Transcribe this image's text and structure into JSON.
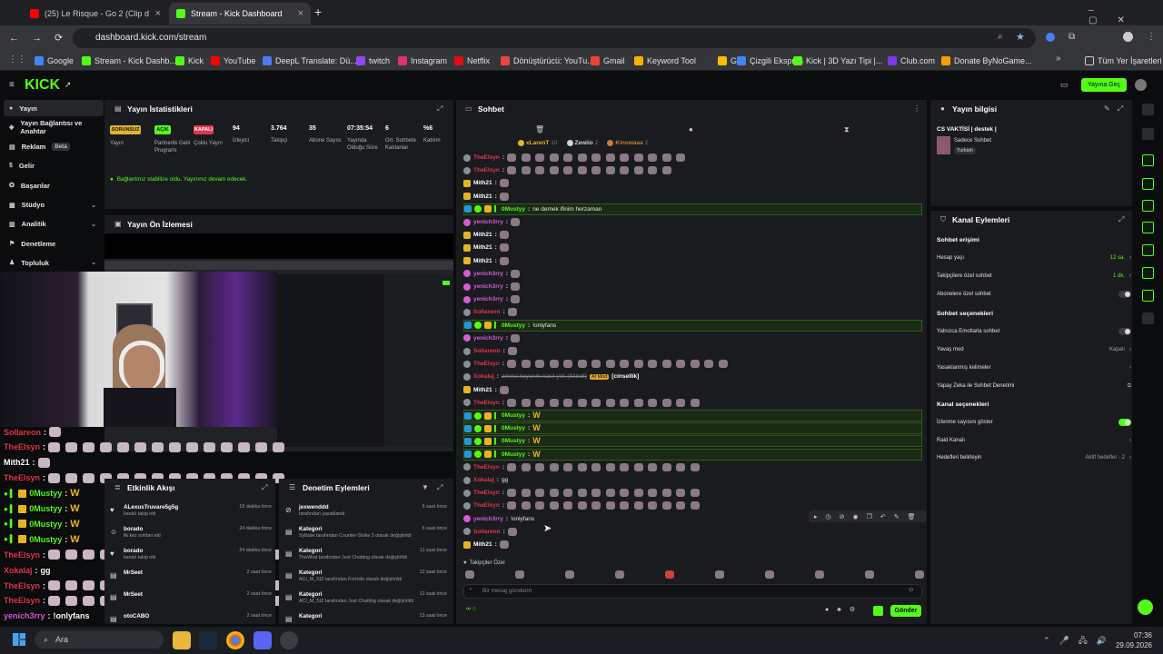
{
  "browser": {
    "tabs": [
      {
        "title": "(25) Le Risque - Go 2 (Clip d"
      },
      {
        "title": "Stream - Kick Dashboard"
      }
    ],
    "url": "dashboard.kick.com/stream",
    "bookmarks": [
      "Google",
      "Stream - Kick Dashb...",
      "Kick",
      "YouTube",
      "DeepL Translate: Dü...",
      "twitch",
      "Instagram",
      "Netflix",
      "Dönüştürücü: YouTu...",
      "Gmail",
      "Keyword Tool",
      "G...",
      "Çizgili Ekspres",
      "Kick | 3D Yazı Tipi |...",
      "Club.com",
      "Donate ByNoGame..."
    ],
    "all_bookmarks": "Tüm Yer İşaretleri"
  },
  "kick": {
    "logo": "KICK",
    "go_live": "Yayına Geç"
  },
  "sidebar": {
    "items": [
      {
        "label": "Yayın"
      },
      {
        "label": "Yayın Bağlantısı ve Anahtar"
      },
      {
        "label": "Reklam",
        "badge": "Beta"
      },
      {
        "label": "Gelir"
      },
      {
        "label": "Başarılar"
      },
      {
        "label": "Stüdyo"
      },
      {
        "label": "Analitik"
      },
      {
        "label": "Denetleme"
      },
      {
        "label": "Topluluk"
      }
    ]
  },
  "stats": {
    "title": "Yayın İstatistikleri",
    "items": [
      {
        "pill": "SORUNSUZ",
        "label": "Yayın"
      },
      {
        "pill": "AÇIK",
        "label": "Partnerlik Gelir Programı"
      },
      {
        "pill": "KAPALI",
        "label": "Çoklu Yayın"
      },
      {
        "value": "94",
        "label": "İzleyici"
      },
      {
        "value": "3.764",
        "label": "Takipçi"
      },
      {
        "value": "35",
        "label": "Abone Sayısı"
      },
      {
        "value": "07:35:54",
        "label": "Yayında Olduğu Süre"
      },
      {
        "value": "6",
        "label": "Ort. Sohbete Katılanlar"
      },
      {
        "value": "%6",
        "label": "Katılım"
      }
    ],
    "notice": "Bağlantınız stabilize oldu. Yayınınız devam edecek."
  },
  "preview": {
    "title": "Yayın Ön İzlemesi"
  },
  "overlay_chat": [
    {
      "name": "Sollareon",
      "color": "red",
      "emotes": 1
    },
    {
      "name": "TheElsyn",
      "color": "red",
      "emotes": 14
    },
    {
      "name": "Mith21",
      "color": "white",
      "emotes": 1
    },
    {
      "name": "TheElsyn",
      "color": "red",
      "emotes": 14
    },
    {
      "name": "0Mustyy",
      "color": "green",
      "emotes": 1,
      "badges": true
    },
    {
      "name": "0Mustyy",
      "color": "green",
      "emotes": 1,
      "badges": true
    },
    {
      "name": "0Mustyy",
      "color": "green",
      "emotes": 1,
      "badges": true
    },
    {
      "name": "0Mustyy",
      "color": "green",
      "emotes": 1,
      "badges": true
    },
    {
      "name": "TheElsyn",
      "color": "red",
      "emotes": 14
    },
    {
      "name": "Xokalaj",
      "color": "red",
      "text": "gg"
    },
    {
      "name": "TheElsyn",
      "color": "red",
      "emotes": 14
    },
    {
      "name": "TheElsyn",
      "color": "red",
      "emotes": 14
    },
    {
      "name": "yenich3rry",
      "color": "pink",
      "text": "!onlyfans"
    },
    {
      "name": "Sollareon",
      "color": "red",
      "emotes": 0
    },
    {
      "name": "Mith21",
      "color": "white",
      "emotes": 0
    }
  ],
  "activity": {
    "title": "Etkinlik Akışı",
    "items": [
      {
        "title": "ALexusTruvare5g5g",
        "desc": "kanalı takip etti",
        "time": "19 dakika önce"
      },
      {
        "title": "borado",
        "desc": "ilk kez sohbet etti",
        "time": "24 dakika önce"
      },
      {
        "title": "borado",
        "desc": "kanalı takip etti",
        "time": "24 dakika önce"
      },
      {
        "title": "MrSeet",
        "desc": "",
        "time": "2 saat önce"
      },
      {
        "title": "MrSeet",
        "desc": "",
        "time": "2 saat önce"
      },
      {
        "title": "otoCABO",
        "desc": "",
        "time": "2 saat önce"
      }
    ]
  },
  "mod": {
    "title": "Denetim Eylemleri",
    "items": [
      {
        "title": "jexwenddd",
        "desc": "tarafından yasaklandı",
        "time": "6 saat önce"
      },
      {
        "title": "Kategori",
        "desc": "Syllube tarafından Counter-Strike 2 olarak değiştirildi",
        "time": "6 saat önce"
      },
      {
        "title": "Kategori",
        "desc": "TheWrat tarafından Just Chatting olarak değiştirildi",
        "time": "11 saat önce"
      },
      {
        "title": "Kategori",
        "desc": "ACI_M_SIZ tarafından Fortnite olarak değiştirildi",
        "time": "12 saat önce"
      },
      {
        "title": "Kategori",
        "desc": "ACI_M_SIZ tarafından Just Chatting olarak değiştirildi",
        "time": "12 saat önce"
      },
      {
        "title": "Kategori",
        "desc": "",
        "time": "13 saat önce"
      }
    ]
  },
  "chat": {
    "title": "Sohbet",
    "top_gifters": [
      {
        "name": "xLarenT",
        "n": "10"
      },
      {
        "name": "Zewiio",
        "n": "2"
      },
      {
        "name": "Kinowaaa",
        "n": "2"
      }
    ],
    "lines": [
      {
        "name": "TheElsyn",
        "color": "red",
        "emotes": 13
      },
      {
        "name": "TheElsyn",
        "color": "red",
        "emotes": 12
      },
      {
        "name": "Mith21",
        "color": "white",
        "emotes": 1
      },
      {
        "name": "Mith21",
        "color": "white",
        "emotes": 1
      },
      {
        "name": "0Mustyy",
        "color": "green",
        "text": "ne demek ifinim herzaman",
        "hl": true,
        "badges": true
      },
      {
        "name": "yenich3rry",
        "color": "pink",
        "emotes": 1
      },
      {
        "name": "Mith21",
        "color": "white",
        "emotes": 1
      },
      {
        "name": "Mith21",
        "color": "white",
        "emotes": 1
      },
      {
        "name": "Mith21",
        "color": "white",
        "emotes": 1
      },
      {
        "name": "yenich3rry",
        "color": "pink",
        "emotes": 1
      },
      {
        "name": "yenich3rry",
        "color": "pink",
        "emotes": 1
      },
      {
        "name": "yenich3rry",
        "color": "pink",
        "emotes": 1
      },
      {
        "name": "Sollareon",
        "color": "red",
        "emotes": 1
      },
      {
        "name": "0Mustyy",
        "color": "green",
        "text": "!onlyfans",
        "hl": true,
        "badges": true
      },
      {
        "name": "yenich3rry",
        "color": "pink",
        "emotes": 1
      },
      {
        "name": "Sollareon",
        "color": "red",
        "emotes": 1
      },
      {
        "name": "TheElsyn",
        "color": "red",
        "emotes": 16
      },
      {
        "name": "Xokalaj",
        "color": "red",
        "text": "amına koyarım nasıl yok (Silindi)",
        "tag": "AI Mod",
        "tag2": "[cinsellik]"
      },
      {
        "name": "Mith21",
        "color": "white",
        "emotes": 1
      },
      {
        "name": "TheElsyn",
        "color": "red",
        "emotes": 14
      },
      {
        "name": "0Mustyy",
        "color": "green",
        "w": true,
        "hl": true,
        "badges": true
      },
      {
        "name": "0Mustyy",
        "color": "green",
        "w": true,
        "hl": true,
        "badges": true
      },
      {
        "name": "0Mustyy",
        "color": "green",
        "w": true,
        "hl": true,
        "badges": true
      },
      {
        "name": "0Mustyy",
        "color": "green",
        "w": true,
        "hl": true,
        "badges": true
      },
      {
        "name": "TheElsyn",
        "color": "red",
        "emotes": 14
      },
      {
        "name": "Xokalaj",
        "color": "red",
        "text": "gg"
      },
      {
        "name": "TheElsyn",
        "color": "red",
        "emotes": 14
      },
      {
        "name": "TheElsyn",
        "color": "red",
        "emotes": 14
      },
      {
        "name": "yenich3rry",
        "color": "pink",
        "text": "!onlyfans"
      },
      {
        "name": "Sollareon",
        "color": "red",
        "emotes": 1
      },
      {
        "name": "Mith21",
        "color": "white",
        "emotes": 1
      }
    ],
    "followers_only": "Takipçiler Özel",
    "input_placeholder": "Bir mesaj gönderin",
    "send": "Gönder"
  },
  "stream_info": {
    "title": "Yayın bilgisi",
    "stream_title": "CS VAKTİSİ | destek |",
    "category": "Sadece Sohbet",
    "language": "Turkish"
  },
  "channel": {
    "title": "Kanal Eylemleri",
    "chat_access": "Sohbet erişimi",
    "rows1": [
      {
        "label": "Hesap yaşı",
        "value": "12 sa."
      },
      {
        "label": "Takipçilere özel sohbet",
        "value": "1 dk."
      },
      {
        "label": "Abonelere özel sohbet",
        "toggle": false
      }
    ],
    "chat_options": "Sohbet seçenekleri",
    "rows2": [
      {
        "label": "Yalnızca Emotlarla sohbet",
        "toggle": false
      },
      {
        "label": "Yavaş mod",
        "value": "Kapalı"
      },
      {
        "label": "Yasaklanmış kelimeler",
        "value": ""
      },
      {
        "label": "Yapay Zeka ile Sohbet Denetimi",
        "value": ""
      }
    ],
    "channel_options": "Kanal seçenekleri",
    "rows3": [
      {
        "label": "İzlenme sayısını göster",
        "toggle": true
      },
      {
        "label": "Raid Kanalı",
        "value": ""
      },
      {
        "label": "Hedefleri belirleyin",
        "value": "Aktif hedefler - 2"
      }
    ]
  },
  "taskbar": {
    "search": "Ara",
    "time": "07:36",
    "date": "29.09.2026"
  },
  "colors": {
    "accent": "#53fc18",
    "red": "#e2364b",
    "pink": "#d55dd4",
    "green": "#53fc18"
  }
}
